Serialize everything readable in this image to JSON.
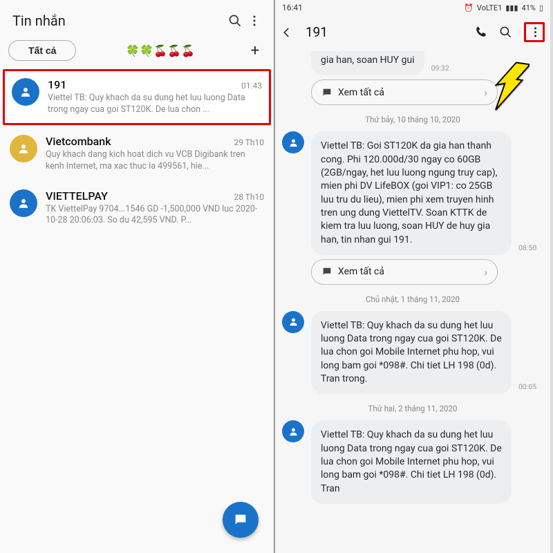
{
  "left": {
    "header_title": "Tin nhắn",
    "filter_chip": "Tất cả",
    "emoji_row": "🍀🍀🍒🍒🍒",
    "conversations": [
      {
        "name": "191",
        "time": "01:43",
        "preview": "Viettel TB: Quy khach da su dung het luu luong Data trong ngay cua goi ST120K. De lua chon ...",
        "avatar_color": "blue",
        "highlight": true
      },
      {
        "name": "Vietcombank",
        "time": "29 Th10",
        "preview": "Quy khach dang kich hoat dich vu VCB Digibank tren kenh Internet, ma xac thuc la 499561, hie...",
        "avatar_color": "yellow",
        "highlight": false
      },
      {
        "name": "VIETTELPAY",
        "time": "28 Th10",
        "preview": "TK ViettelPay 9704...1546 GD -1,500,000 VND luc 2020-10-28 20:06:03. So du 42,595 VND. P...",
        "avatar_color": "blue",
        "highlight": false
      }
    ]
  },
  "right": {
    "status_time": "16:41",
    "status_battery": "41%",
    "status_net": "VoLTE1",
    "thread_title": "191",
    "partial_top_text": "gia han, soan HUY gui",
    "partial_top_time": "09:32",
    "view_all_label": "Xem tất cả",
    "messages": [
      {
        "date_separator": "Thứ bảy, 10 tháng 10, 2020",
        "text": "Viettel TB: Goi ST120K da gia han thanh cong. Phi 120.000d/30 ngay co 60GB (2GB/ngay, het luu luong ngung truy cap), mien phi DV LifeBOX (goi VIP1: co 25GB luu tru du lieu), mien phi xem truyen hinh tren ung dung ViettelTV. Soan KTTK de kiem tra luu luong, soan HUY de huy gia han, tin nhan gui 191.",
        "time": "08:50",
        "show_action": true
      },
      {
        "date_separator": "Chủ nhật, 1 tháng 11, 2020",
        "text": "Viettel TB: Quy khach da su dung het luu luong Data trong ngay cua goi ST120K. De lua chon goi Mobile Internet phu hop, vui long bam goi *098#. Chi tiet LH 198 (0d). Tran trong.",
        "time": "00:05",
        "show_action": false
      },
      {
        "date_separator": "Thứ hai, 2 tháng 11, 2020",
        "text": "Viettel TB: Quy khach da su dung het luu luong Data trong ngay cua goi ST120K. De lua chon goi Mobile Internet phu hop, vui long bam goi *098#. Chi tiet LH 198 (0d). Tran",
        "time": "",
        "show_action": false
      }
    ]
  }
}
